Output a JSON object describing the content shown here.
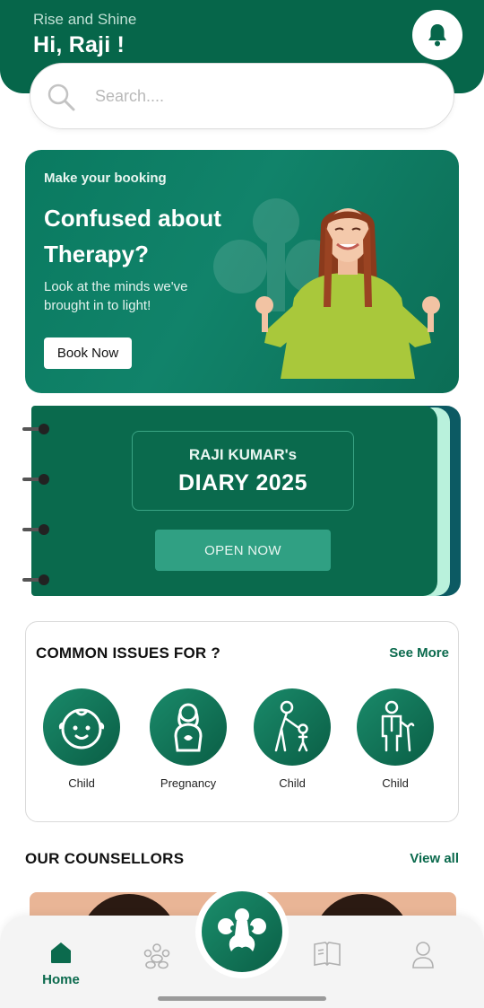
{
  "header": {
    "greeting_sub": "Rise and Shine",
    "greeting_main": "Hi, Raji  !",
    "notification_icon": "bell-icon"
  },
  "search": {
    "placeholder": "Search....",
    "icon": "search-icon"
  },
  "promo": {
    "kicker": "Make your booking",
    "title": "Confused about Therapy?",
    "description": "Look at the minds we've brought in to light!",
    "button_label": "Book Now"
  },
  "diary": {
    "owner": "RAJI KUMAR's",
    "title": "DIARY 2025",
    "button_label": "OPEN NOW"
  },
  "issues": {
    "title": "COMMON ISSUES FOR ?",
    "see_more": "See More",
    "items": [
      {
        "label": "Child",
        "icon": "baby-face-icon"
      },
      {
        "label": "Pregnancy",
        "icon": "pregnancy-icon"
      },
      {
        "label": "Child",
        "icon": "parent-child-icon"
      },
      {
        "label": "Child",
        "icon": "elderly-icon"
      }
    ]
  },
  "counsellors": {
    "title": "OUR COUNSELLORS",
    "view_all": "View all"
  },
  "nav": {
    "home_label": "Home",
    "items": [
      "home-icon",
      "community-icon",
      "app-logo-icon",
      "book-icon",
      "profile-icon"
    ]
  },
  "colors": {
    "primary": "#06664a",
    "accent": "#30a083",
    "mint": "#b9f1dc"
  }
}
